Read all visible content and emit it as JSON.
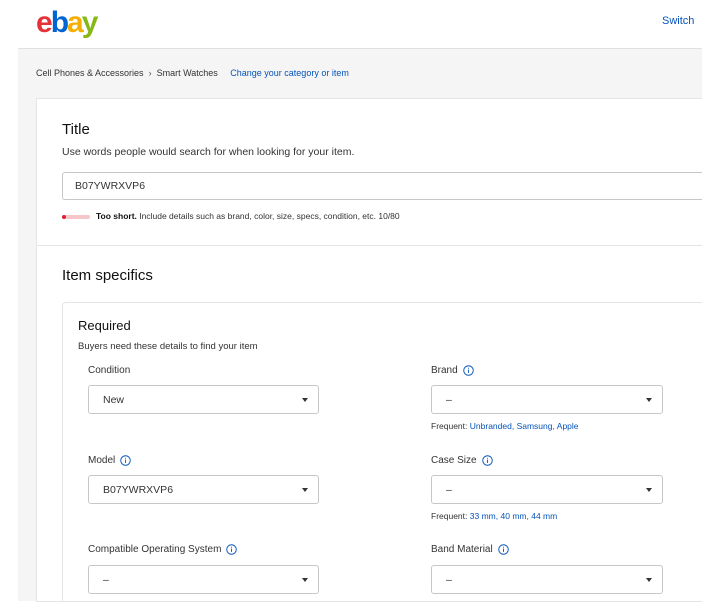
{
  "header": {
    "logo_letters": [
      "e",
      "b",
      "a",
      "y"
    ],
    "switch_label": "Switch"
  },
  "breadcrumb": {
    "items": [
      "Cell Phones & Accessories",
      "Smart Watches"
    ],
    "separator": "›",
    "change_link": "Change your category or item"
  },
  "title_section": {
    "heading": "Title",
    "subtitle": "Use words people would search for when looking for your item.",
    "value": "B07YWRXVP6",
    "meter_fill": 0.125,
    "meter_strong": "Too short.",
    "meter_text": " Include details such as brand, color, size, specs, condition, etc. 10/80"
  },
  "item_specifics": {
    "heading": "Item specifics",
    "required_heading": "Required",
    "required_subtitle": "Buyers need these details to find your item",
    "fields": {
      "condition": {
        "label": "Condition",
        "value": "New"
      },
      "brand": {
        "label": "Brand",
        "value": "–",
        "frequent_label": "Frequent:",
        "frequent_values": [
          "Unbranded",
          "Samsung",
          "Apple"
        ]
      },
      "model": {
        "label": "Model",
        "value": "B07YWRXVP6"
      },
      "case_size": {
        "label": "Case Size",
        "value": "–",
        "frequent_label": "Frequent:",
        "frequent_values": [
          "33 mm",
          "40 mm",
          "44 mm"
        ]
      },
      "os": {
        "label": "Compatible Operating System",
        "value": "–"
      },
      "band_material": {
        "label": "Band Material",
        "value": "–"
      }
    }
  },
  "colors": {
    "link": "#0654ba",
    "meter_bar": "#e0212e",
    "meter_track": "#f7c6cb"
  }
}
